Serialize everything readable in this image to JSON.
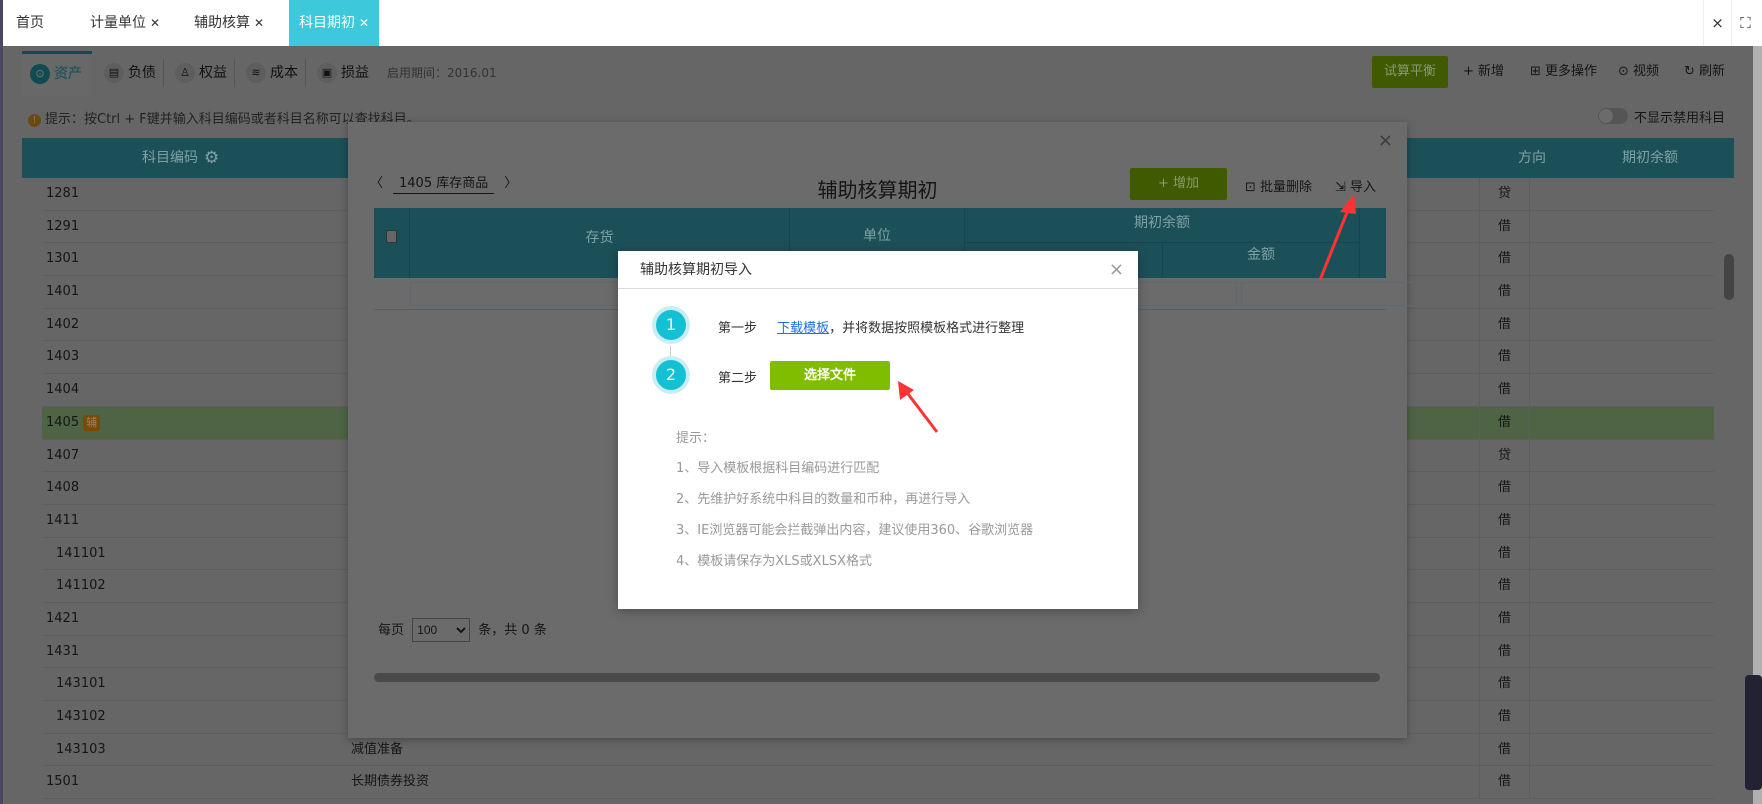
{
  "tabs": [
    {
      "label": "首页"
    },
    {
      "label": "计量单位"
    },
    {
      "label": "辅助核算"
    },
    {
      "label": "科目期初",
      "active": true
    }
  ],
  "window": {
    "close": "×",
    "fullscreen": "⛶"
  },
  "subtabs": [
    {
      "label": "资产",
      "icon": "asset-icon"
    },
    {
      "label": "负债",
      "icon": "liability-icon"
    },
    {
      "label": "权益",
      "icon": "equity-icon"
    },
    {
      "label": "成本",
      "icon": "cost-icon"
    },
    {
      "label": "损益",
      "icon": "profit-loss-icon"
    }
  ],
  "period": "启用期间：2016.01",
  "toolbar": {
    "trial": "试算平衡",
    "add": "+ 新增",
    "more": "更多操作",
    "video": "视频",
    "refresh": "刷新"
  },
  "tip": "提示：按Ctrl + F键并输入科目编码或者科目名称可以查找科目。",
  "toggle_label": "不显示禁用科目",
  "table": {
    "headers": {
      "code": "科目编码",
      "direction": "方向",
      "balance": "期初余额"
    },
    "rows": [
      {
        "code": "1281",
        "dir": "贷"
      },
      {
        "code": "1291",
        "dir": "借"
      },
      {
        "code": "1301",
        "dir": "借"
      },
      {
        "code": "1401",
        "dir": "借"
      },
      {
        "code": "1402",
        "dir": "借"
      },
      {
        "code": "1403",
        "dir": "借"
      },
      {
        "code": "1404",
        "dir": "借"
      },
      {
        "code": "1405",
        "dir": "借",
        "badge": "辅",
        "highlight": true
      },
      {
        "code": "1407",
        "dir": "贷"
      },
      {
        "code": "1408",
        "dir": "借"
      },
      {
        "code": "1411",
        "dir": "借"
      },
      {
        "code": "141101",
        "dir": "借",
        "sub": true
      },
      {
        "code": "141102",
        "dir": "借",
        "sub": true
      },
      {
        "code": "1421",
        "dir": "借"
      },
      {
        "code": "1431",
        "dir": "借"
      },
      {
        "code": "143101",
        "dir": "借",
        "sub": true
      },
      {
        "code": "143102",
        "dir": "借",
        "sub": true
      },
      {
        "code": "143103",
        "dir": "借",
        "sub": true,
        "name": "减值准备"
      },
      {
        "code": "1501",
        "dir": "借",
        "name": "长期债券投资"
      }
    ]
  },
  "outer": {
    "close": "×",
    "prev": "〈",
    "next": "〉",
    "account": "1405  库存商品",
    "title": "辅助核算期初",
    "add": "+ 增加",
    "batch_delete": "批量删除",
    "import": "导入",
    "columns": {
      "inventory": "存货",
      "unit": "单位",
      "opening": "期初余额",
      "amount": "金额"
    },
    "pager": {
      "per_page": "每页",
      "size": "100",
      "suffix": "条，共 0 条"
    }
  },
  "dialog": {
    "title": "辅助核算期初导入",
    "close": "×",
    "step1": {
      "num": "1",
      "label": "第一步",
      "link": "下载模板",
      "text": "，并将数据按照模板格式进行整理"
    },
    "step2": {
      "num": "2",
      "label": "第二步",
      "button": "选择文件"
    },
    "hints": [
      "提示：",
      "1、导入模板根据科目编码进行匹配",
      "2、先维护好系统中科目的数量和币种，再进行导入",
      "3、IE浏览器可能会拦截弹出内容，建议使用360、谷歌浏览器",
      "4、模板请保存为XLS或XLSX格式"
    ]
  }
}
